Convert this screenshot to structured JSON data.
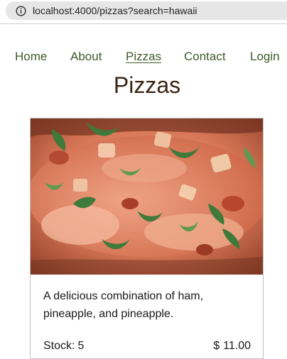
{
  "browser": {
    "url": "localhost:4000/pizzas?search=hawaii",
    "info_icon": "info-icon"
  },
  "nav": {
    "items": [
      {
        "label": "Home"
      },
      {
        "label": "About"
      },
      {
        "label": "Pizzas",
        "active": true
      },
      {
        "label": "Contact"
      },
      {
        "label": "Login"
      }
    ]
  },
  "page": {
    "title": "Pizzas"
  },
  "pizza": {
    "description": "A delicious combination of ham, pineapple, and pineapple.",
    "stock_label": "Stock:",
    "stock_value": "5",
    "currency": "$",
    "price": "11.00"
  },
  "colors": {
    "nav_link": "#3e5a2a",
    "title": "#3a2410",
    "urlbar_bg": "#e6e6e6"
  }
}
